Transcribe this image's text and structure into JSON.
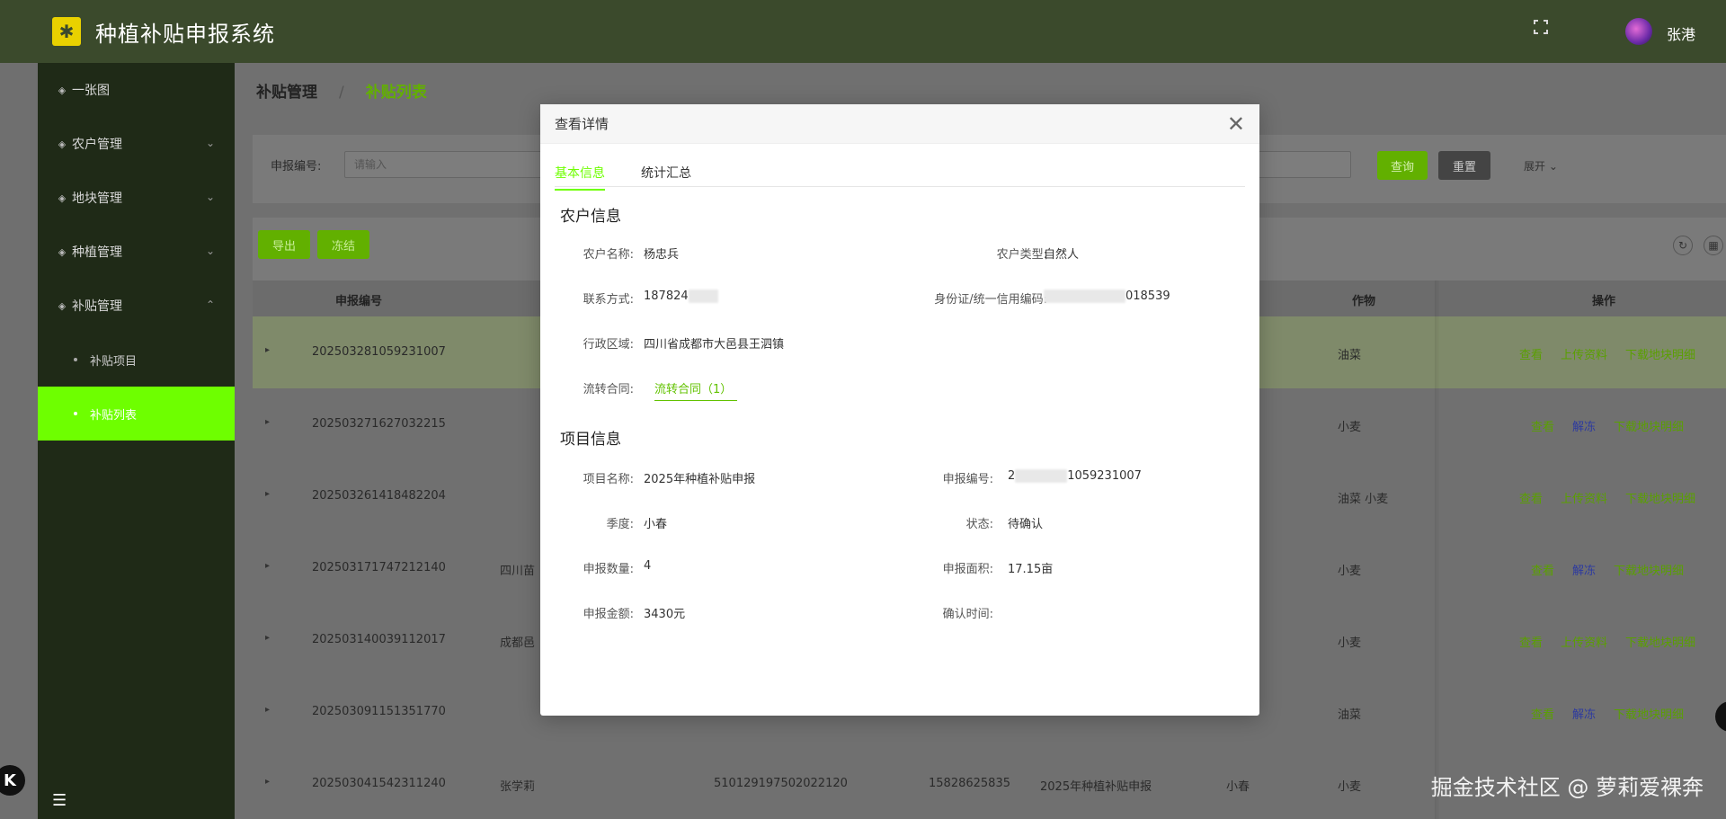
{
  "app": {
    "title": "种植补贴申报系统",
    "logo_symbol": "✱",
    "username": "张港"
  },
  "sidebar": {
    "items": [
      {
        "label": "一张图",
        "icon": "diamond-icon"
      },
      {
        "label": "农户管理",
        "icon": "diamond-icon",
        "chevron": "⌄"
      },
      {
        "label": "地块管理",
        "icon": "diamond-icon",
        "chevron": "⌄"
      },
      {
        "label": "种植管理",
        "icon": "diamond-icon",
        "chevron": "⌄"
      },
      {
        "label": "补贴管理",
        "icon": "diamond-icon",
        "chevron": "⌃"
      }
    ],
    "sub_items": [
      {
        "label": "补贴项目"
      },
      {
        "label": "补贴列表",
        "active": true
      }
    ],
    "collapse_symbol": "☰"
  },
  "breadcrumb": {
    "parent": "补贴管理",
    "separator": "/",
    "current": "补贴列表"
  },
  "search": {
    "label": "申报编号:",
    "placeholder": "请输入",
    "query_button": "查询",
    "reset_button": "重置",
    "expand_label": "展开 ⌄"
  },
  "toolbar": {
    "export_button": "导出",
    "freeze_button": "冻结"
  },
  "table": {
    "headers": {
      "report_no": "申报编号",
      "crop": "作物",
      "actions": "操作"
    },
    "rows": [
      {
        "report_no": "202503281059231007",
        "name": "",
        "id_no": "",
        "phone": "",
        "project": "",
        "season": "",
        "crop": "油菜",
        "actions": [
          "查看",
          "上传资料",
          "下载地块明细"
        ]
      },
      {
        "report_no": "202503271627032215",
        "name": "",
        "id_no": "",
        "phone": "",
        "project": "",
        "season": "",
        "crop": "小麦",
        "actions": [
          "查看",
          "解冻",
          "下载地块明细"
        ]
      },
      {
        "report_no": "202503261418482204",
        "name": "",
        "id_no": "",
        "phone": "",
        "project": "",
        "season": "",
        "crop": "油菜  小麦",
        "actions": [
          "查看",
          "上传资料",
          "下载地块明细"
        ]
      },
      {
        "report_no": "202503171747212140",
        "name": "四川苗",
        "id_no": "",
        "phone": "",
        "project": "",
        "season": "",
        "crop": "小麦",
        "actions": [
          "查看",
          "解冻",
          "下载地块明细"
        ]
      },
      {
        "report_no": "202503140039112017",
        "name": "成都邑",
        "id_no": "",
        "phone": "",
        "project": "",
        "season": "",
        "crop": "小麦",
        "actions": [
          "查看",
          "上传资料",
          "下载地块明细"
        ]
      },
      {
        "report_no": "202503091151351770",
        "name": "",
        "id_no": "",
        "phone": "",
        "project": "",
        "season": "",
        "crop": "油菜",
        "actions": [
          "查看",
          "解冻",
          "下载地块明细"
        ]
      },
      {
        "report_no": "202503041542311240",
        "name": "张学莉",
        "id_no": "510129197502022120",
        "phone": "15828625835",
        "project": "2025年种植补贴申报",
        "season": "小春",
        "crop": "小麦",
        "actions": []
      }
    ]
  },
  "modal": {
    "title": "查看详情",
    "close_symbol": "✕",
    "tabs": [
      "基本信息",
      "统计汇总"
    ],
    "farmer_section": {
      "title": "农户信息",
      "name_label": "农户名称:",
      "name_value": "杨忠兵",
      "type_label": "农户类型:",
      "type_value": "自然人",
      "contact_label": "联系方式:",
      "contact_value": "187824",
      "id_label": "身份证/统一信用编码:",
      "id_value": "018539",
      "region_label": "行政区域:",
      "region_value": "四川省成都市大邑县王泗镇",
      "contract_label": "流转合同:",
      "contract_value": "流转合同（1）"
    },
    "project_section": {
      "title": "项目信息",
      "project_label": "项目名称:",
      "project_value": "2025年种植补贴申报",
      "report_no_label": "申报编号:",
      "report_no_value": "1059231007",
      "report_no_prefix": "2",
      "season_label": "季度:",
      "season_value": "小春",
      "status_label": "状态:",
      "status_value": "待确认",
      "qty_label": "申报数量:",
      "qty_value": "4",
      "area_label": "申报面积:",
      "area_value": "17.15亩",
      "amount_label": "申报金额:",
      "amount_value": "3430元",
      "confirm_label": "确认时间:",
      "confirm_value": ""
    }
  },
  "watermark": "掘金技术社区 @ 萝莉爱裸奔",
  "colors": {
    "brand_green": "#6eff00",
    "header_bg": "#3b4a2c",
    "sidebar_bg": "#1f2a17",
    "logo_yellow": "#e9d100"
  }
}
